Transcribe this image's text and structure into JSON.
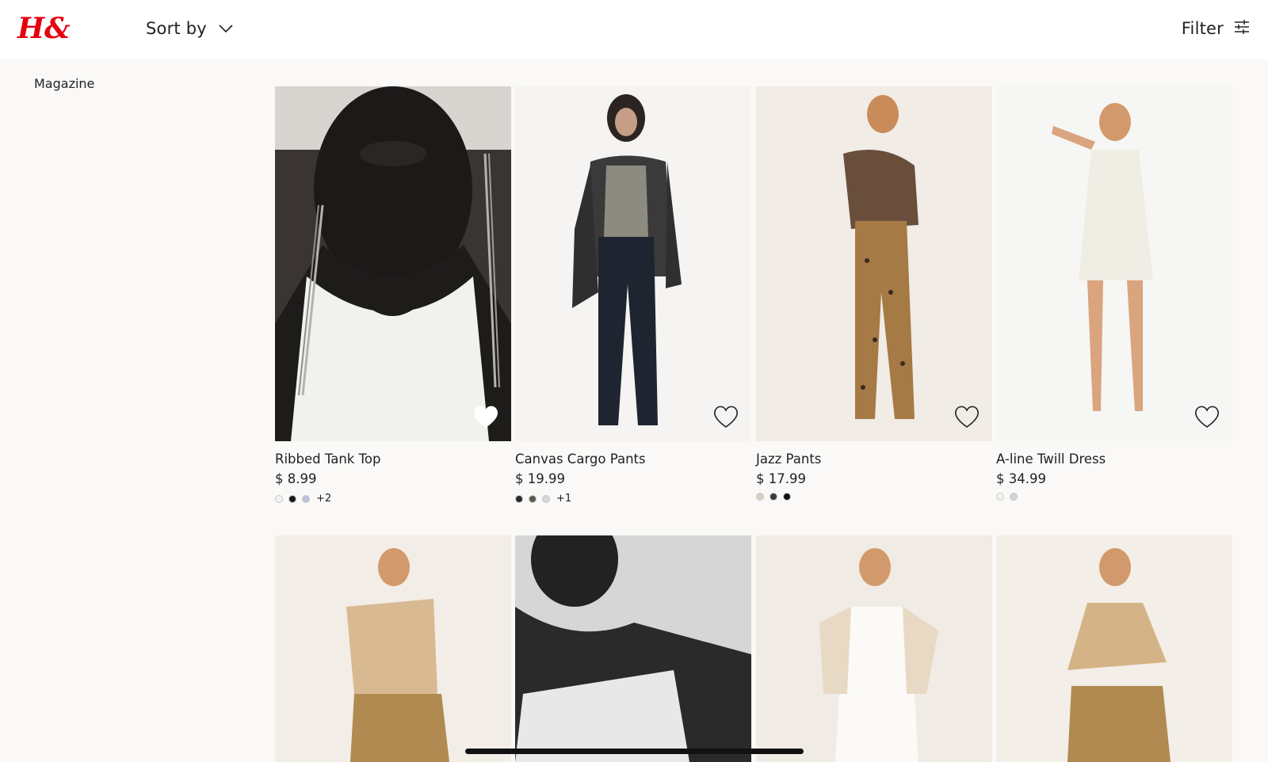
{
  "header": {
    "brand": "H&M",
    "sort_label": "Sort by",
    "filter_label": "Filter"
  },
  "sidebar": {
    "magazine_label": "Magazine"
  },
  "colors": {
    "brand_red": "#e50010",
    "text": "#222222",
    "page_bg": "#faf9f8"
  },
  "products": [
    {
      "name": "Ribbed Tank Top",
      "price": "$ 8.99",
      "swatches": [
        "#f2f2f2",
        "#1a1a1a",
        "#b8c2d8"
      ],
      "more": "+2",
      "favorited": true
    },
    {
      "name": "Canvas Cargo Pants",
      "price": "$ 19.99",
      "swatches": [
        "#2b2b2b",
        "#5a5a4e",
        "#d8d8d8"
      ],
      "more": "+1",
      "favorited": false
    },
    {
      "name": "Jazz Pants",
      "price": "$ 17.99",
      "swatches": [
        "#d9cfc2",
        "#3a3a3a",
        "#111111"
      ],
      "more": "",
      "favorited": false
    },
    {
      "name": "A-line Twill Dress",
      "price": "$ 34.99",
      "swatches": [
        "#f3f1ea",
        "#d4d4d4"
      ],
      "more": "",
      "favorited": false
    }
  ],
  "second_row": [
    {
      "icon": "product-image"
    },
    {
      "icon": "product-image"
    },
    {
      "icon": "product-image"
    },
    {
      "icon": "product-image"
    }
  ]
}
